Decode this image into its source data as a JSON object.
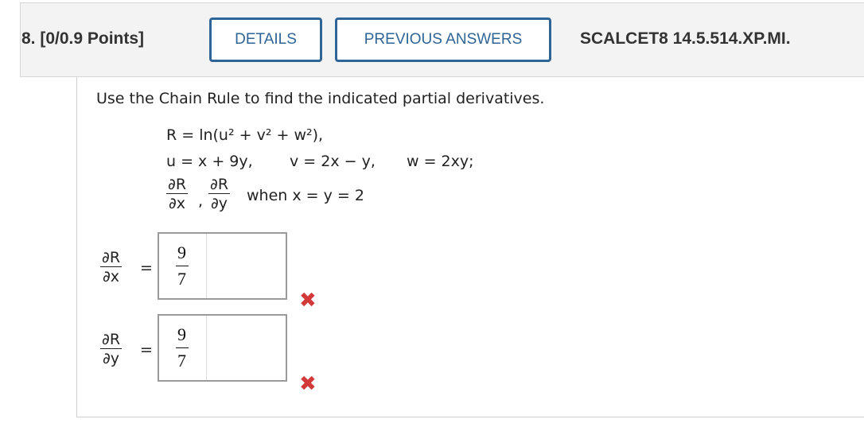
{
  "header": {
    "question_number": "8. [0/0.9 Points]",
    "details_label": "DETAILS",
    "previous_answers_label": "PREVIOUS ANSWERS",
    "reference": "SCALCET8 14.5.514.XP.MI."
  },
  "problem": {
    "prompt": "Use the Chain Rule to find the indicated partial derivatives.",
    "R_def": "R = ln(u² + v² + w²),",
    "u_def": "u = x + 9y,",
    "v_def": "v = 2x − y,",
    "w_def": "w = 2xy;",
    "derivative_num": "∂R",
    "derivative_x_den": "∂x",
    "derivative_y_den": "∂y",
    "condition": "when x = y = 2"
  },
  "answers": [
    {
      "label_num": "∂R",
      "label_den": "∂x",
      "numerator": "9",
      "denominator": "7",
      "status": "incorrect",
      "status_icon": "✖"
    },
    {
      "label_num": "∂R",
      "label_den": "∂y",
      "numerator": "9",
      "denominator": "7",
      "status": "incorrect",
      "status_icon": "✖"
    }
  ],
  "colors": {
    "button_accent": "#2f6497",
    "incorrect": "#d23a3a"
  }
}
